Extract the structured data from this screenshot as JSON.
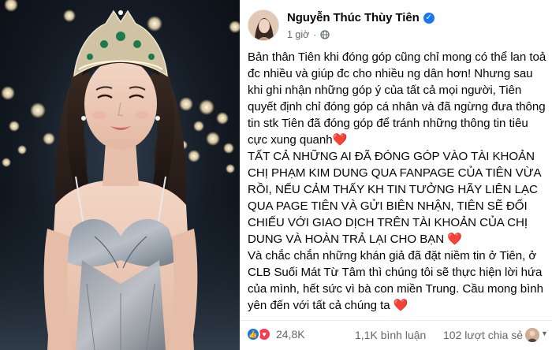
{
  "photo": {
    "description_icon": "photo-of-woman-with-crown"
  },
  "post": {
    "author": "Nguyễn Thúc Thùy Tiên",
    "verified_icon": "verified-badge-icon",
    "time": "1 giờ",
    "separator": "·",
    "privacy_icon": "globe-icon",
    "paragraphs": [
      "Bản thân Tiên khi đóng góp cũng chỉ mong có thể lan toả đc nhiều và giúp đc cho nhiều ng dân hơn! Nhưng sau khi ghi nhận những góp ý của tất cả mọi người, Tiên quyết định chỉ đóng góp cá nhân và đã ngừng đưa thông tin stk Tiên đã đóng góp để tránh những thông tin tiêu cực xung quanh",
      "TẤT CẢ NHỮNG AI ĐÃ ĐÓNG GÓP VÀO TÀI KHOẢN CHỊ PHẠM KIM DUNG QUA FANPAGE CỦA TIÊN VỪA RỒI, NẾU CẢM THẤY KH TIN TƯỞNG HÃY LIÊN LẠC QUA PAGE TIÊN VÀ GỬI BIÊN NHẬN, TIÊN SẼ ĐỐI CHIẾU VỚI GIAO DỊCH TRÊN TÀI KHOẢN CỦA CHỊ DUNG VÀ HOÀN TRẢ LẠI CHO BẠN",
      "Và chắc chắn những khán giả đã đặt niềm tin ở Tiên, ở CLB Suối Mát Từ Tâm thì chúng tôi sẽ thực hiện lời hứa của mình, hết sức vì bà con miền Trung. Cầu mong bình yên đến với tất cả chúng ta"
    ],
    "heart": "❤️",
    "reactions_count": "24,8K",
    "comments": "1,1K bình luận",
    "shares": "102 lượt chia sẻ"
  },
  "colors": {
    "facebook_blue": "#1877f2",
    "love_red": "#f33e58",
    "meta_gray": "#65676b"
  }
}
